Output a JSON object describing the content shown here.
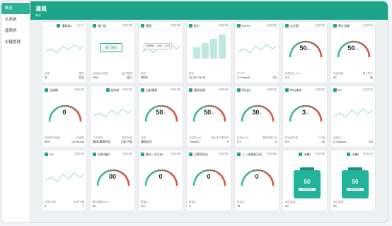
{
  "sidebar": {
    "items": [
      "概览",
      "水系统",
      "基质桥",
      "水罐管理"
    ]
  },
  "header": {
    "title": "灌溉",
    "subtitle": "概况"
  },
  "cards": [
    {
      "title": "灌溉机1",
      "more": "运行中",
      "icon": "irrigation-machine-icon",
      "foot": [
        [
          "状态",
          "模式"
        ],
        [
          "开",
          "手动"
        ]
      ]
    },
    {
      "title": "阀门组",
      "more": "查看详情",
      "icon": "valve-icon",
      "valve_label": "阀门组1",
      "foot": [
        [
          "当前运行状态",
          "运行/暂停"
        ],
        [
          "45%",
          "运行"
        ]
      ]
    },
    {
      "title": "管理",
      "more": "查看详情",
      "icon": "manage-icon",
      "tooltip": "分块阀1  · 0834 · 1024",
      "foot": [
        [
          "地块",
          ""
        ],
        [
          "地块1",
          ""
        ]
      ]
    },
    {
      "title": "配方",
      "more": "查看详情",
      "icon": "recipe-icon",
      "labels": [
        "A1",
        "B2",
        "C3",
        "D5"
      ],
      "foot": [
        [
          "配方",
          ""
        ],
        [
          "A1 B2 C3 D5",
          ""
        ]
      ]
    },
    {
      "title": "EC/PH",
      "more": "查看详情",
      "icon": "chart-icon",
      "foot": [
        [
          "EC/PH",
          ""
        ],
        [
          "2.3 ms/cm",
          "6.5"
        ]
      ]
    },
    {
      "title": "水压值",
      "more": "查看详情",
      "icon": "pressure-icon",
      "gauge": "50",
      "unit": "bar",
      "foot": [
        [
          "设定压力 bar",
          ""
        ],
        [
          "0.5",
          ""
        ]
      ]
    },
    {
      "title": "累计流量",
      "more": "查看详情",
      "icon": "flow-icon",
      "gauge": "50",
      "unit": "L/H",
      "foot": [
        [
          "设定流量",
          "累计时长"
        ],
        [
          "50",
          "28"
        ]
      ]
    },
    {
      "title": "回液桶",
      "more": "查看详情",
      "icon": "bucket-icon",
      "gauge": "0",
      "foot": [
        [
          "当前液位高度",
          "回液泵"
        ],
        [
          "60%",
          "00 mL/cm"
        ]
      ]
    },
    {
      "title": "苗床架",
      "more": "查看详情",
      "icon": "rack-icon",
      "foot": [
        [
          "工作状态",
          "液位状态"
        ],
        [
          "液体/灌溉开启",
          "上架/下架"
        ]
      ]
    },
    {
      "title": "当前灌溉",
      "more": "查看详情",
      "icon": "current-icon",
      "gauge": "50",
      "unit": "%",
      "foot": [
        [
          "状态",
          ""
        ],
        [
          "灌溉运行",
          ""
        ]
      ]
    },
    {
      "title": "灌溉总量",
      "more": "查看详情",
      "icon": "total-icon",
      "gauge": "50",
      "unit": "ml",
      "foot": [
        [
          "设定量(ml)",
          "设定量下降时间"
        ],
        [
          "17664.6",
          "0"
        ]
      ]
    },
    {
      "title": "排出比",
      "more": "查看详情",
      "icon": "ratio-icon",
      "gauge": "30",
      "unit": "%",
      "foot": [
        [
          "排出比(%)",
          "灌溉次数(次)"
        ],
        [
          "2.3",
          "5"
        ]
      ]
    },
    {
      "title": "排出液体",
      "more": "查看详情",
      "icon": "drain-icon",
      "gauge": "3",
      "unit": "%",
      "foot": [
        [
          "排出液体量",
          "EC值"
        ],
        [
          "0.5",
          "00"
        ]
      ]
    },
    {
      "title": "EC",
      "more": "查看详情",
      "icon": "ec-icon",
      "foot": [
        [
          "回液EC",
          ""
        ],
        [
          "2.3 ms/cm",
          "6.5"
        ]
      ]
    },
    {
      "title": "PH",
      "more": "查看详情",
      "icon": "ph-icon",
      "foot": [
        [
          "当前PH值",
          "目标PH值"
        ],
        [
          "5",
          "7"
        ]
      ]
    },
    {
      "title": "光照/辐射",
      "more": "查看详情",
      "icon": "sun-icon",
      "gauge": "00",
      "foot": [
        [
          "累计辐射(J/m)",
          ""
        ],
        [
          "00",
          ""
        ]
      ]
    },
    {
      "title": "最后一次开启",
      "more": "查看详情",
      "icon": "last-on-icon",
      "gauge": "0",
      "foot": [
        [
          "累量(L)",
          ""
        ],
        [
          "0.8",
          ""
        ]
      ]
    },
    {
      "title": "日累积回出",
      "more": "查看详情",
      "icon": "daily-icon",
      "gauge": "0",
      "foot": [
        [
          "累量(L)",
          ""
        ],
        [
          "5",
          ""
        ]
      ]
    },
    {
      "title": "上一轮灌溉至此",
      "more": "查看详情",
      "icon": "prev-icon",
      "gauge": "0",
      "foot": [
        [
          "累量(L)",
          ""
        ],
        [
          "14",
          ""
        ]
      ]
    },
    {
      "title": "水罐1",
      "more": "查看详情",
      "icon": "tank-icon",
      "tank": "50",
      "badge": "3260308",
      "foot": [
        [
          "液位高度",
          ""
        ],
        [
          "2m",
          ""
        ]
      ]
    },
    {
      "title": "水罐1",
      "more": "查看详情",
      "icon": "tank-icon",
      "tank": "50",
      "badge": "3260308",
      "foot": [
        [
          "液位高度",
          ""
        ],
        [
          "2m",
          ""
        ]
      ]
    }
  ],
  "colors": {
    "accent": "#1aa58a",
    "gauge_gradient_start": "#2dbf9a",
    "gauge_gradient_end": "#e04b3c"
  }
}
